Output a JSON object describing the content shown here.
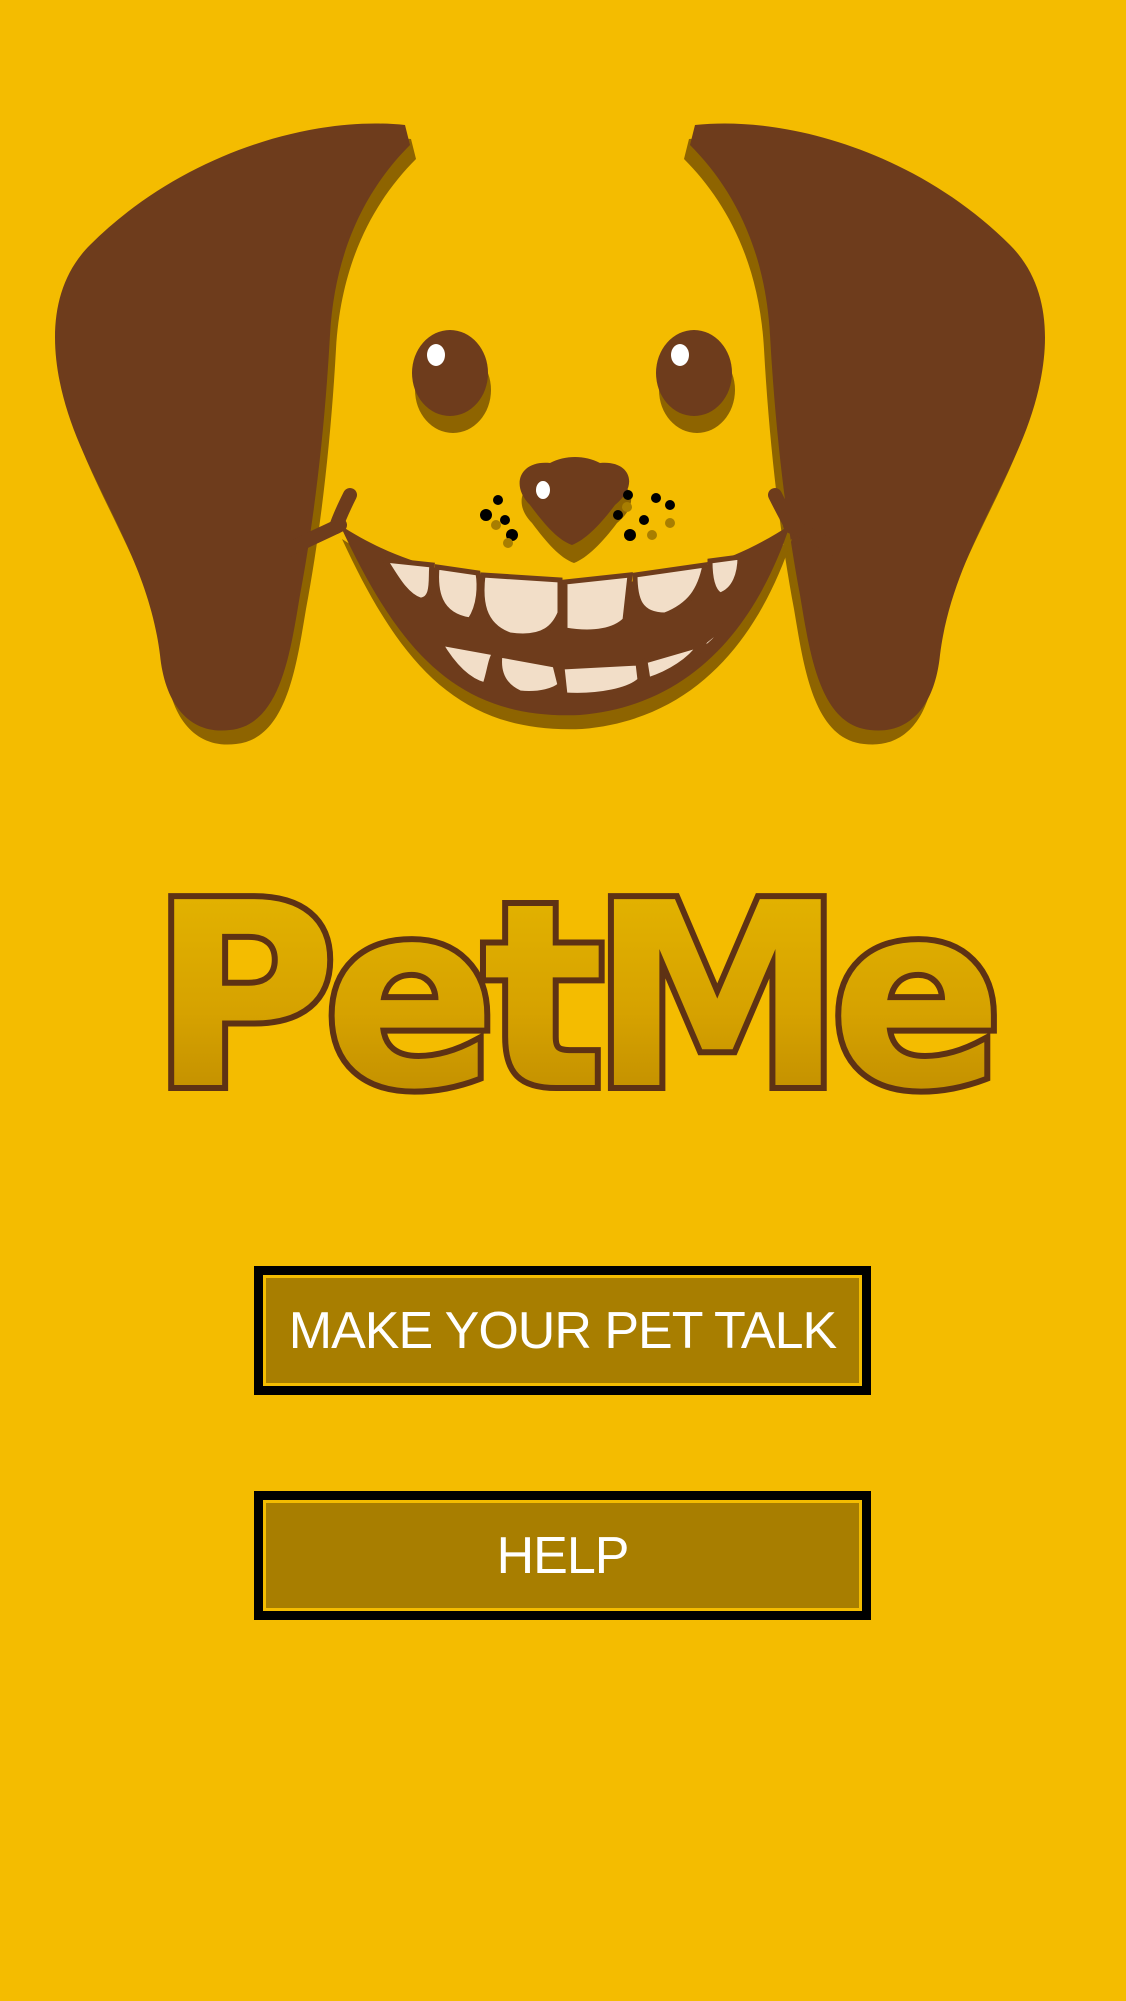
{
  "app": {
    "title": "PetMe"
  },
  "mascot": {
    "icon": "dog-face-icon"
  },
  "buttons": {
    "talk_label": "MAKE YOUR PET TALK",
    "help_label": "HELP"
  },
  "colors": {
    "background": "#F4BC00",
    "button_fill": "#A87E00",
    "button_border": "#000000",
    "brown": "#6E3C1C",
    "logo_fill": "#D9A500"
  }
}
